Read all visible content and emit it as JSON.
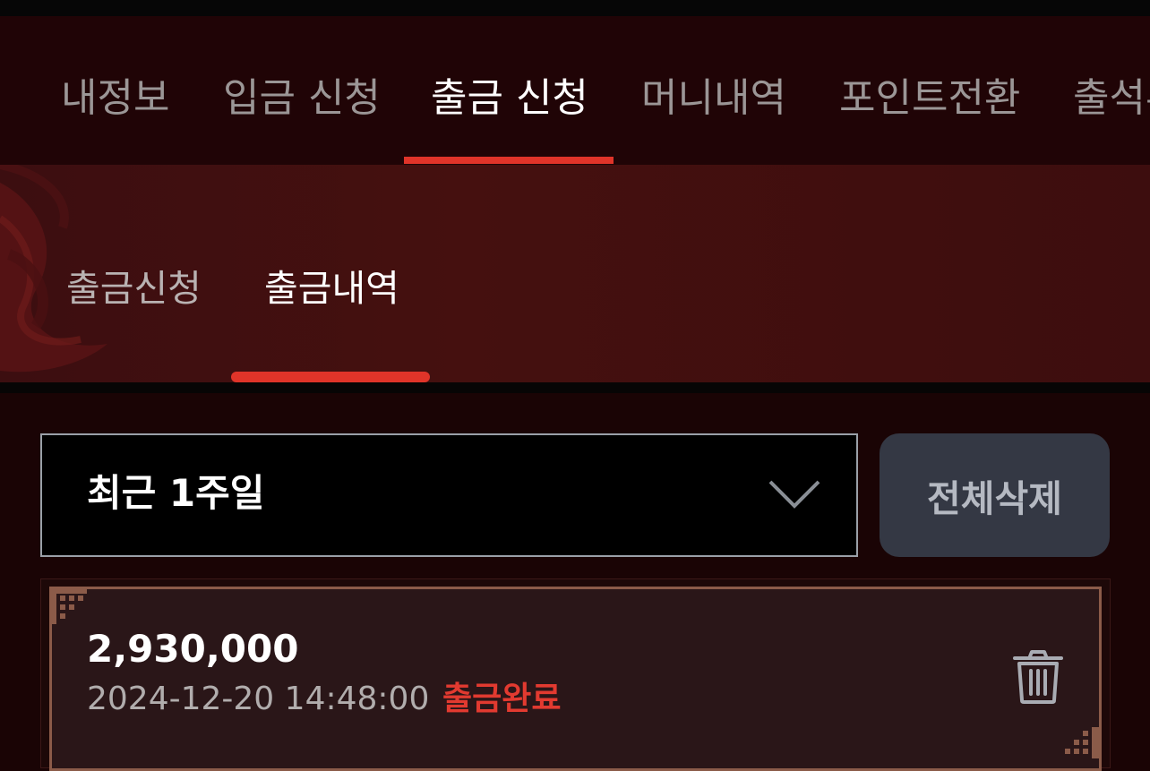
{
  "main_tabs": [
    {
      "label": "내정보",
      "active": false
    },
    {
      "label": "입금 신청",
      "active": false
    },
    {
      "label": "출금 신청",
      "active": true
    },
    {
      "label": "머니내역",
      "active": false
    },
    {
      "label": "포인트전환",
      "active": false
    },
    {
      "label": "출석부",
      "active": false
    }
  ],
  "sub_tabs": [
    {
      "label": "출금신청",
      "active": false
    },
    {
      "label": "출금내역",
      "active": true
    }
  ],
  "filter": {
    "period_selected": "최근 1주일",
    "delete_all_label": "전체삭제"
  },
  "records": [
    {
      "amount": "2,930,000",
      "datetime": "2024-12-20 14:48:00",
      "status": "출금완료"
    }
  ],
  "icons": {
    "dropdown": "chevron-down-icon",
    "delete": "trash-icon"
  },
  "colors": {
    "accent": "#e03429",
    "status_complete": "#e23a30",
    "button_bg": "#343844",
    "card_border": "#8b5b49"
  }
}
